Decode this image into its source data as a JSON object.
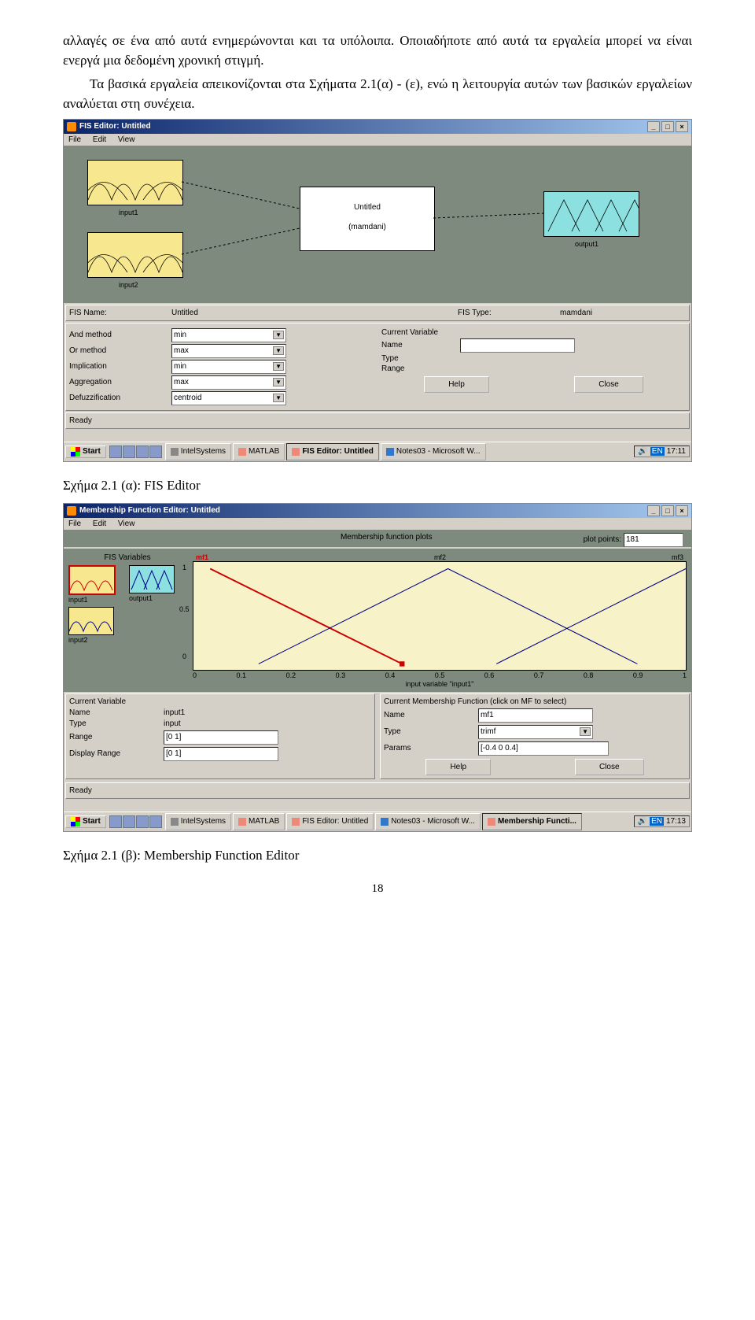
{
  "text": {
    "para1": "αλλαγές σε ένα από αυτά ενημερώνονται και τα υπόλοιπα. Οποιαδήποτε από αυτά τα εργαλεία μπορεί να είναι ενεργά μια δεδομένη χρονική στιγμή.",
    "para2": "Τα βασικά εργαλεία απεικονίζονται στα Σχήματα 2.1(α) - (ε), ενώ η λειτουργία αυτών των βασικών εργαλείων αναλύεται στη συνέχεια.",
    "caption1": "Σχήμα 2.1 (α):  FIS Editor",
    "caption2": "Σχήμα 2.1 (β):  Membership Function Editor",
    "pagenum": "18"
  },
  "fis": {
    "title": "FIS Editor: Untitled",
    "menu": {
      "file": "File",
      "edit": "Edit",
      "view": "View"
    },
    "diagram": {
      "input1": "input1",
      "input2": "input2",
      "ruletitle": "Untitled",
      "ruletype": "(mamdani)",
      "output1": "output1"
    },
    "namepanel": {
      "lbl_name": "FIS Name:",
      "val_name": "Untitled",
      "lbl_type": "FIS Type:",
      "val_type": "mamdani"
    },
    "methods": {
      "and": "And method",
      "and_v": "min",
      "or": "Or method",
      "or_v": "max",
      "imp": "Implication",
      "imp_v": "min",
      "agg": "Aggregation",
      "agg_v": "max",
      "def": "Defuzzification",
      "def_v": "centroid"
    },
    "curvar": {
      "title": "Current Variable",
      "name": "Name",
      "type": "Type",
      "range": "Range"
    },
    "buttons": {
      "help": "Help",
      "close": "Close"
    },
    "status": "Ready",
    "taskbar": {
      "start": "Start",
      "t1": "IntelSystems",
      "t2": "MATLAB",
      "t3": "FIS Editor: Untitled",
      "t4": "Notes03 - Microsoft W...",
      "lang": "EN",
      "time": "17:11"
    }
  },
  "mf": {
    "title": "Membership Function Editor: Untitled",
    "menu": {
      "file": "File",
      "edit": "Edit",
      "view": "View"
    },
    "fisvars": {
      "label": "FIS Variables",
      "in1": "input1",
      "in2": "input2",
      "out1": "output1"
    },
    "plot": {
      "title": "Membership function plots",
      "plotpoints_lbl": "plot points:",
      "plotpoints_val": "181",
      "mf1": "mf1",
      "mf2": "mf2",
      "mf3": "mf3",
      "xlabel": "input variable \"input1\"",
      "xticks": [
        "0",
        "0.1",
        "0.2",
        "0.3",
        "0.4",
        "0.5",
        "0.6",
        "0.7",
        "0.8",
        "0.9",
        "1"
      ],
      "yticks": [
        "0",
        "0.5",
        "1"
      ]
    },
    "cvpanel": {
      "title": "Current Variable",
      "name_lbl": "Name",
      "name_val": "input1",
      "type_lbl": "Type",
      "type_val": "input",
      "range_lbl": "Range",
      "range_val": "[0 1]",
      "drange_lbl": "Display Range",
      "drange_val": "[0 1]"
    },
    "cmfpanel": {
      "title": "Current Membership Function (click on MF to select)",
      "name_lbl": "Name",
      "name_val": "mf1",
      "type_lbl": "Type",
      "type_val": "trimf",
      "params_lbl": "Params",
      "params_val": "[-0.4 0 0.4]"
    },
    "buttons": {
      "help": "Help",
      "close": "Close"
    },
    "status": "Ready",
    "taskbar": {
      "start": "Start",
      "t1": "IntelSystems",
      "t2": "MATLAB",
      "t3": "FIS Editor: Untitled",
      "t4": "Notes03 - Microsoft W...",
      "t5": "Membership Functi...",
      "lang": "EN",
      "time": "17:13"
    }
  },
  "chart_data": {
    "type": "line",
    "title": "Membership function plots",
    "xlabel": "input variable \"input1\"",
    "ylabel": "",
    "xlim": [
      0,
      1
    ],
    "ylim": [
      0,
      1
    ],
    "series": [
      {
        "name": "mf1",
        "x": [
          -0.4,
          0,
          0.4
        ],
        "y": [
          0,
          1,
          0
        ],
        "params": [
          -0.4,
          0,
          0.4
        ],
        "mf_type": "trimf"
      },
      {
        "name": "mf2",
        "x": [
          0.1,
          0.5,
          0.9
        ],
        "y": [
          0,
          1,
          0
        ],
        "params": [
          0.1,
          0.5,
          0.9
        ],
        "mf_type": "trimf"
      },
      {
        "name": "mf3",
        "x": [
          0.6,
          1.0,
          1.4
        ],
        "y": [
          0,
          1,
          0
        ],
        "params": [
          0.6,
          1.0,
          1.4
        ],
        "mf_type": "trimf"
      }
    ],
    "xticks": [
      0,
      0.1,
      0.2,
      0.3,
      0.4,
      0.5,
      0.6,
      0.7,
      0.8,
      0.9,
      1
    ],
    "yticks": [
      0,
      0.5,
      1
    ]
  }
}
